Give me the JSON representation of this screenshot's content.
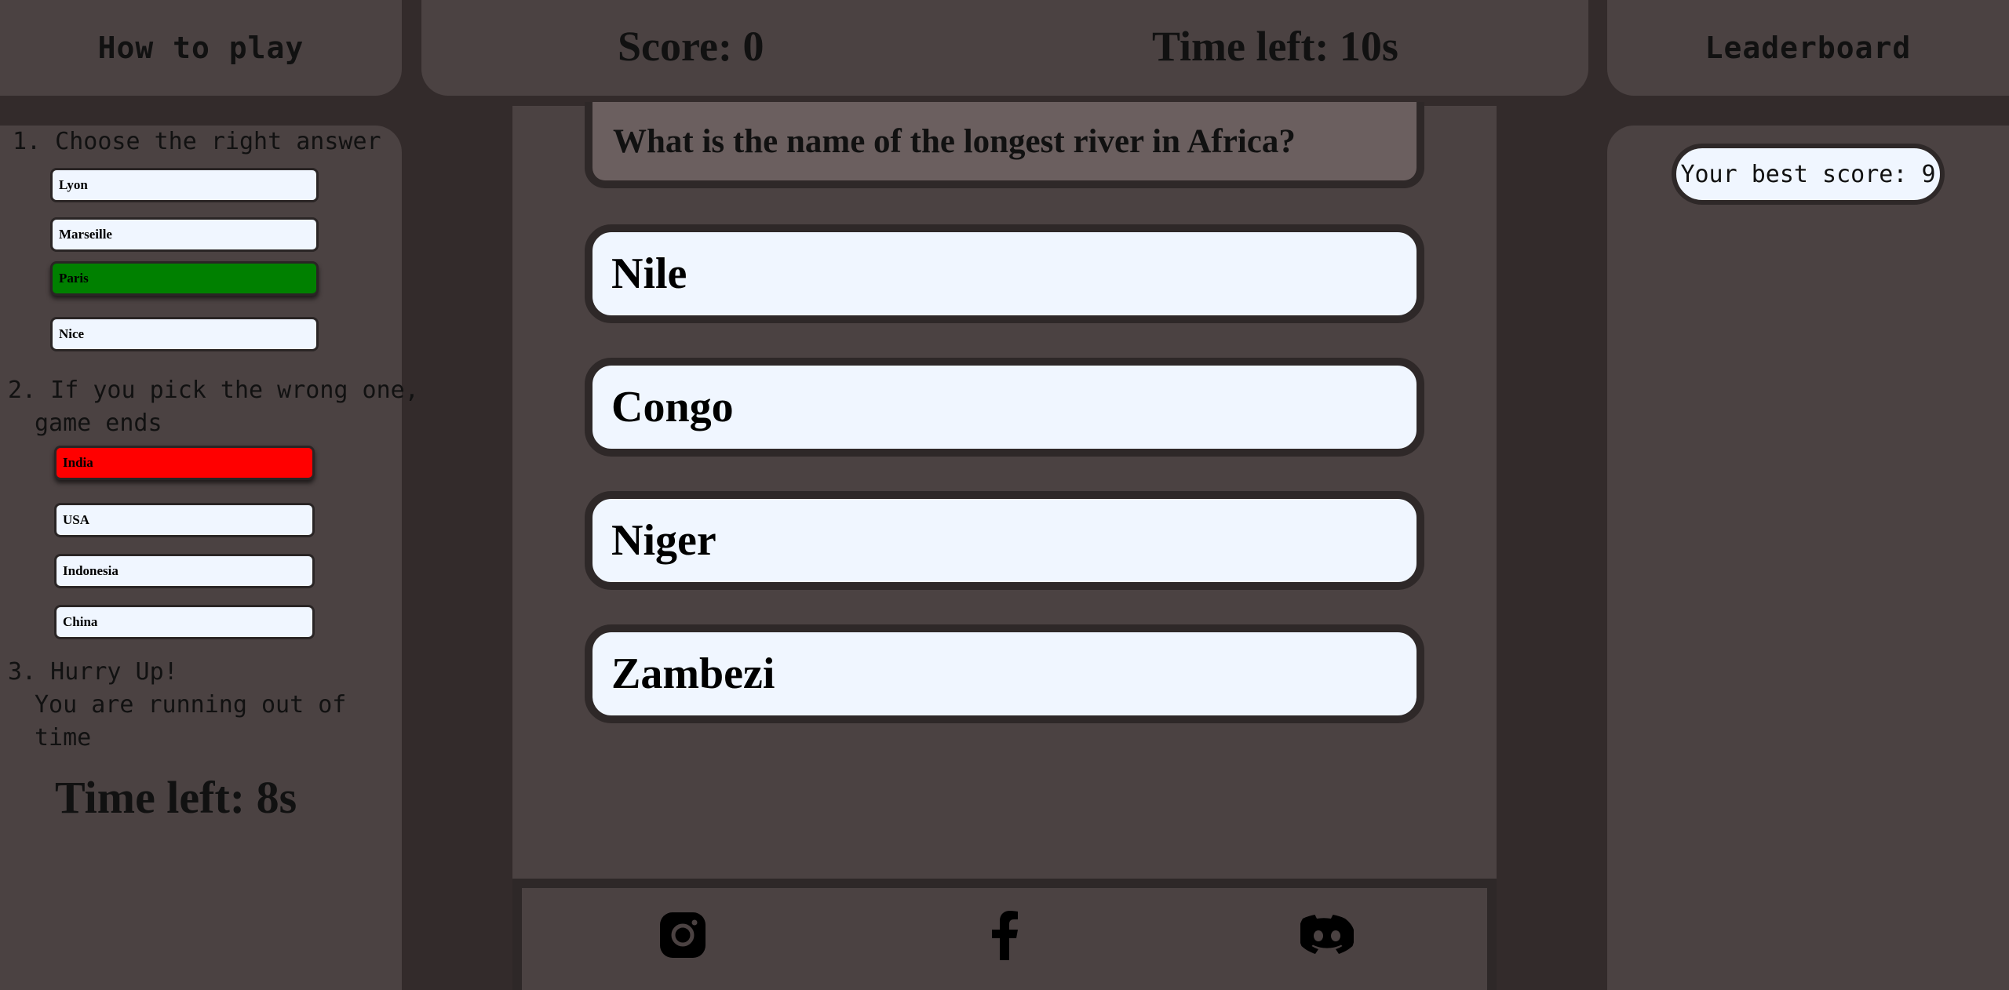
{
  "left_panel": {
    "title": "How to play",
    "step1": {
      "text": "1. Choose the right answer",
      "options": [
        "Lyon",
        "Marseille",
        "Paris",
        "Nice"
      ]
    },
    "step2": {
      "line1": "2. If you pick the wrong one,",
      "line2": "game ends",
      "options": [
        "India",
        "USA",
        "Indonesia",
        "China"
      ]
    },
    "step3": {
      "line1": "3. Hurry Up!",
      "line2": "You are running out of",
      "line3": "time"
    },
    "demo_timer": "Time left: 8s"
  },
  "header": {
    "score": "Score: 0",
    "time_left": "Time left: 10s"
  },
  "question": {
    "text": "What is the name of the longest river in Africa?",
    "answers": [
      "Nile",
      "Congo",
      "Niger",
      "Zambezi"
    ]
  },
  "footer": {
    "icons": [
      "instagram-icon",
      "facebook-icon",
      "discord-icon"
    ]
  },
  "right_panel": {
    "title": "Leaderboard",
    "best_score": "Your best score: 9"
  },
  "colors": {
    "background": "#332b2b",
    "panel": "#4b4242",
    "answer_bg": "#f0f6ff",
    "correct": "#008000",
    "wrong": "#ff0000"
  }
}
